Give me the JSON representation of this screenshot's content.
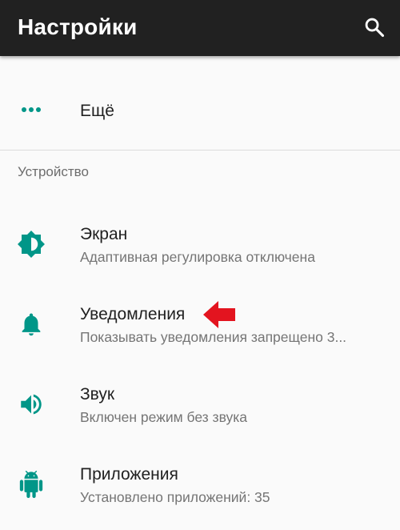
{
  "toolbar": {
    "title": "Настройки",
    "search_icon": "search-icon"
  },
  "more_item": {
    "label": "Ещё",
    "icon": "more-horizontal-icon"
  },
  "section": {
    "title": "Устройство"
  },
  "items": [
    {
      "title": "Экран",
      "subtitle": "Адаптивная регулировка отключена",
      "icon": "brightness-icon"
    },
    {
      "title": "Уведомления",
      "subtitle": "Показывать уведомления запрещено 3...",
      "icon": "bell-icon"
    },
    {
      "title": "Звук",
      "subtitle": "Включен режим без звука",
      "icon": "volume-icon"
    },
    {
      "title": "Приложения",
      "subtitle": "Установлено приложений: 35",
      "icon": "android-icon"
    }
  ],
  "colors": {
    "toolbar": "#212121",
    "accent": "#009688",
    "annotation_arrow": "#e3141f",
    "background": "#fafafa"
  }
}
